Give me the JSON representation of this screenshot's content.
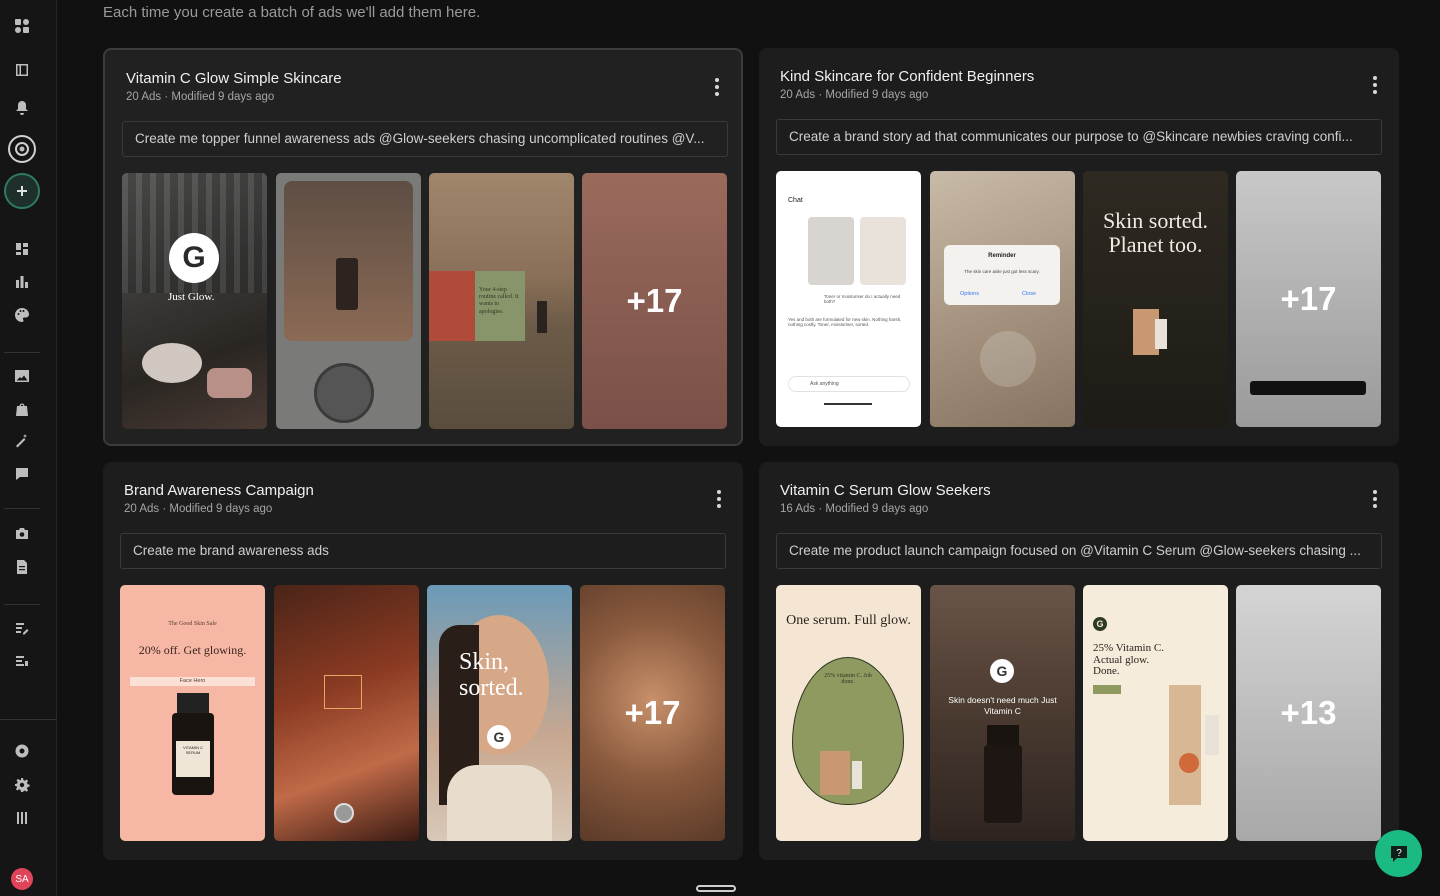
{
  "header": {
    "subtitle": "Each time you create a batch of ads we'll add them here."
  },
  "sidebar": {
    "avatar": "SA",
    "icons": [
      "app-logo-icon",
      "panel-icon",
      "bell-icon",
      "brand-icon",
      "plus-icon",
      "dashboard-icon",
      "chart-icon",
      "palette-icon",
      "image-icon",
      "bag-icon",
      "magic-wand-icon",
      "feedback-icon",
      "camera-icon",
      "document-icon",
      "list-edit-icon",
      "list-icon",
      "support-icon",
      "settings-icon",
      "tools-icon"
    ]
  },
  "cards": [
    {
      "title": "Vitamin C Glow Simple Skincare",
      "meta": "20 Ads · Modified 9 days ago",
      "prompt": "Create me topper funnel awareness ads @Glow-seekers chasing uncomplicated routines @V...",
      "more": "+17",
      "thumb_texts": {
        "t1_caption": "Just Glow.",
        "t3_caption": "Your 4-step routine called. It wants to apologise."
      }
    },
    {
      "title": "Kind Skincare for Confident Beginners",
      "meta": "20 Ads · Modified 9 days ago",
      "prompt": "Create a brand story ad that communicates our purpose to @Skincare newbies craving confi...",
      "more": "+17",
      "thumb_texts": {
        "chat_label": "Chat",
        "chat_bubble": "Toner or moisturiser do I actually need both?",
        "chat_reply": "Yes and both are formulated for new skin. Nothing harsh, nothing costly. Toner, moisturiser, sorted.",
        "chat_input": "Ask anything",
        "reminder_title": "Reminder",
        "reminder_body": "The skin care aisle just got less scary.",
        "reminder_options": "Options",
        "reminder_close": "Close",
        "headline": "Skin sorted. Planet too."
      }
    },
    {
      "title": "Brand Awareness Campaign",
      "meta": "20 Ads · Modified 9 days ago",
      "prompt": "Create me brand awareness ads",
      "more": "+17",
      "thumb_texts": {
        "sale_brand": "The Good Skin Sale",
        "sale_headline": "20% off. Get glowing.",
        "sale_tag": "Face Hero",
        "serum_label": "VITAMIN C SERUM",
        "portrait_headline": "Skin, sorted."
      }
    },
    {
      "title": "Vitamin C Serum Glow Seekers",
      "meta": "16 Ads · Modified 9 days ago",
      "prompt": "Create me product launch campaign focused on @Vitamin C Serum @Glow-seekers chasing ...",
      "more": "+13",
      "thumb_texts": {
        "egg_headline": "One serum. Full glow.",
        "egg_sub": "25% vitamin C. Job done.",
        "caption_two": "Skin doesn't need much Just Vitamin C",
        "vit_headline": "25% Vitamin C. Actual glow. Done."
      }
    }
  ],
  "colors": {
    "accent": "#1cba83",
    "avatar": "#e0445a",
    "card_bg": "#1d1d1d",
    "page_bg": "#111111"
  }
}
